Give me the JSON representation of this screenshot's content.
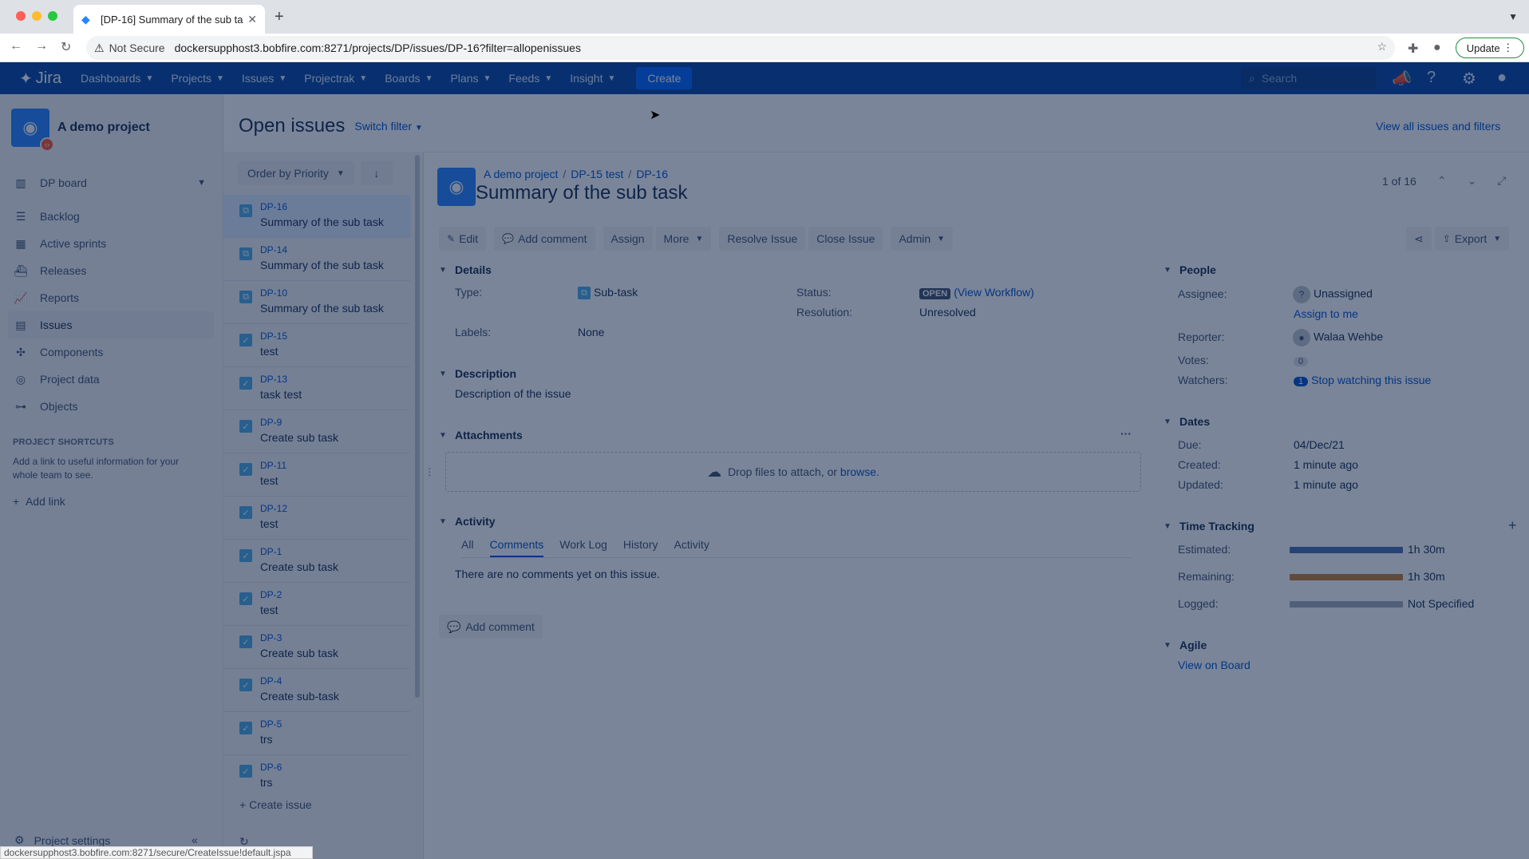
{
  "browser": {
    "tab_title": "[DP-16] Summary of the sub ta",
    "security": "Not Secure",
    "url": "dockersupphost3.bobfire.com:8271/projects/DP/issues/DP-16?filter=allopenissues",
    "update_label": "Update",
    "status_url": "dockersupphost3.bobfire.com:8271/secure/CreateIssue!default.jspa"
  },
  "nav": {
    "logo": "Jira",
    "items": [
      "Dashboards",
      "Projects",
      "Issues",
      "Projectrak",
      "Boards",
      "Plans",
      "Feeds",
      "Insight"
    ],
    "create": "Create",
    "search_placeholder": "Search"
  },
  "sidebar": {
    "project_name": "A demo project",
    "board": "DP board",
    "items": [
      "Backlog",
      "Active sprints",
      "Releases",
      "Reports",
      "Issues",
      "Components",
      "Project data",
      "Objects"
    ],
    "active": "Issues",
    "shortcuts_title": "PROJECT SHORTCUTS",
    "shortcuts_desc": "Add a link to useful information for your whole team to see.",
    "add_link": "Add link",
    "settings": "Project settings"
  },
  "page": {
    "title": "Open issues",
    "switch_filter": "Switch filter",
    "view_all": "View all issues and filters"
  },
  "issue_list": {
    "order_label": "Order by Priority",
    "create_issue": "Create issue",
    "rows": [
      {
        "key": "DP-16",
        "summary": "Summary of the sub task",
        "type": "subtask"
      },
      {
        "key": "DP-14",
        "summary": "Summary of the sub task",
        "type": "subtask"
      },
      {
        "key": "DP-10",
        "summary": "Summary of the sub task",
        "type": "subtask"
      },
      {
        "key": "DP-15",
        "summary": "test",
        "type": "task"
      },
      {
        "key": "DP-13",
        "summary": "task test",
        "type": "task"
      },
      {
        "key": "DP-9",
        "summary": "Create sub task",
        "type": "task"
      },
      {
        "key": "DP-11",
        "summary": "test",
        "type": "task"
      },
      {
        "key": "DP-12",
        "summary": "test",
        "type": "task"
      },
      {
        "key": "DP-1",
        "summary": "Create sub task",
        "type": "task"
      },
      {
        "key": "DP-2",
        "summary": "test",
        "type": "task"
      },
      {
        "key": "DP-3",
        "summary": "Create sub task",
        "type": "task"
      },
      {
        "key": "DP-4",
        "summary": "Create sub-task",
        "type": "task"
      },
      {
        "key": "DP-5",
        "summary": "trs",
        "type": "task"
      },
      {
        "key": "DP-6",
        "summary": "trs",
        "type": "task"
      }
    ]
  },
  "issue": {
    "crumb_project": "A demo project",
    "crumb_parent": "DP-15 test",
    "crumb_key": "DP-16",
    "title": "Summary of the sub task",
    "pager": "1 of 16",
    "toolbar": {
      "edit": "Edit",
      "add_comment": "Add comment",
      "assign": "Assign",
      "more": "More",
      "resolve": "Resolve Issue",
      "close": "Close Issue",
      "admin": "Admin",
      "export": "Export"
    },
    "details": {
      "section": "Details",
      "type_label": "Type:",
      "type_value": "Sub-task",
      "status_label": "Status:",
      "status_value": "OPEN",
      "workflow": "(View Workflow)",
      "resolution_label": "Resolution:",
      "resolution_value": "Unresolved",
      "labels_label": "Labels:",
      "labels_value": "None"
    },
    "description": {
      "section": "Description",
      "text": "Description of the issue"
    },
    "attachments": {
      "section": "Attachments",
      "drop_text": "Drop files to attach, or",
      "browse": "browse."
    },
    "activity": {
      "section": "Activity",
      "tabs": [
        "All",
        "Comments",
        "Work Log",
        "History",
        "Activity"
      ],
      "active_tab": "Comments",
      "empty": "There are no comments yet on this issue.",
      "add_comment": "Add comment"
    },
    "people": {
      "section": "People",
      "assignee_label": "Assignee:",
      "assignee_value": "Unassigned",
      "assign_me": "Assign to me",
      "reporter_label": "Reporter:",
      "reporter_value": "Walaa Wehbe",
      "votes_label": "Votes:",
      "votes_value": "0",
      "watchers_label": "Watchers:",
      "watchers_value": "1",
      "stop_watching": "Stop watching this issue"
    },
    "dates": {
      "section": "Dates",
      "due_label": "Due:",
      "due_value": "04/Dec/21",
      "created_label": "Created:",
      "created_value": "1 minute ago",
      "updated_label": "Updated:",
      "updated_value": "1 minute ago"
    },
    "time_tracking": {
      "section": "Time Tracking",
      "estimated_label": "Estimated:",
      "estimated_value": "1h 30m",
      "estimated_color": "#4a6fb0",
      "remaining_label": "Remaining:",
      "remaining_value": "1h 30m",
      "remaining_color": "#c77e35",
      "logged_label": "Logged:",
      "logged_value": "Not Specified",
      "logged_color": "#a5adba"
    },
    "agile": {
      "section": "Agile",
      "view_on_board": "View on Board"
    }
  }
}
